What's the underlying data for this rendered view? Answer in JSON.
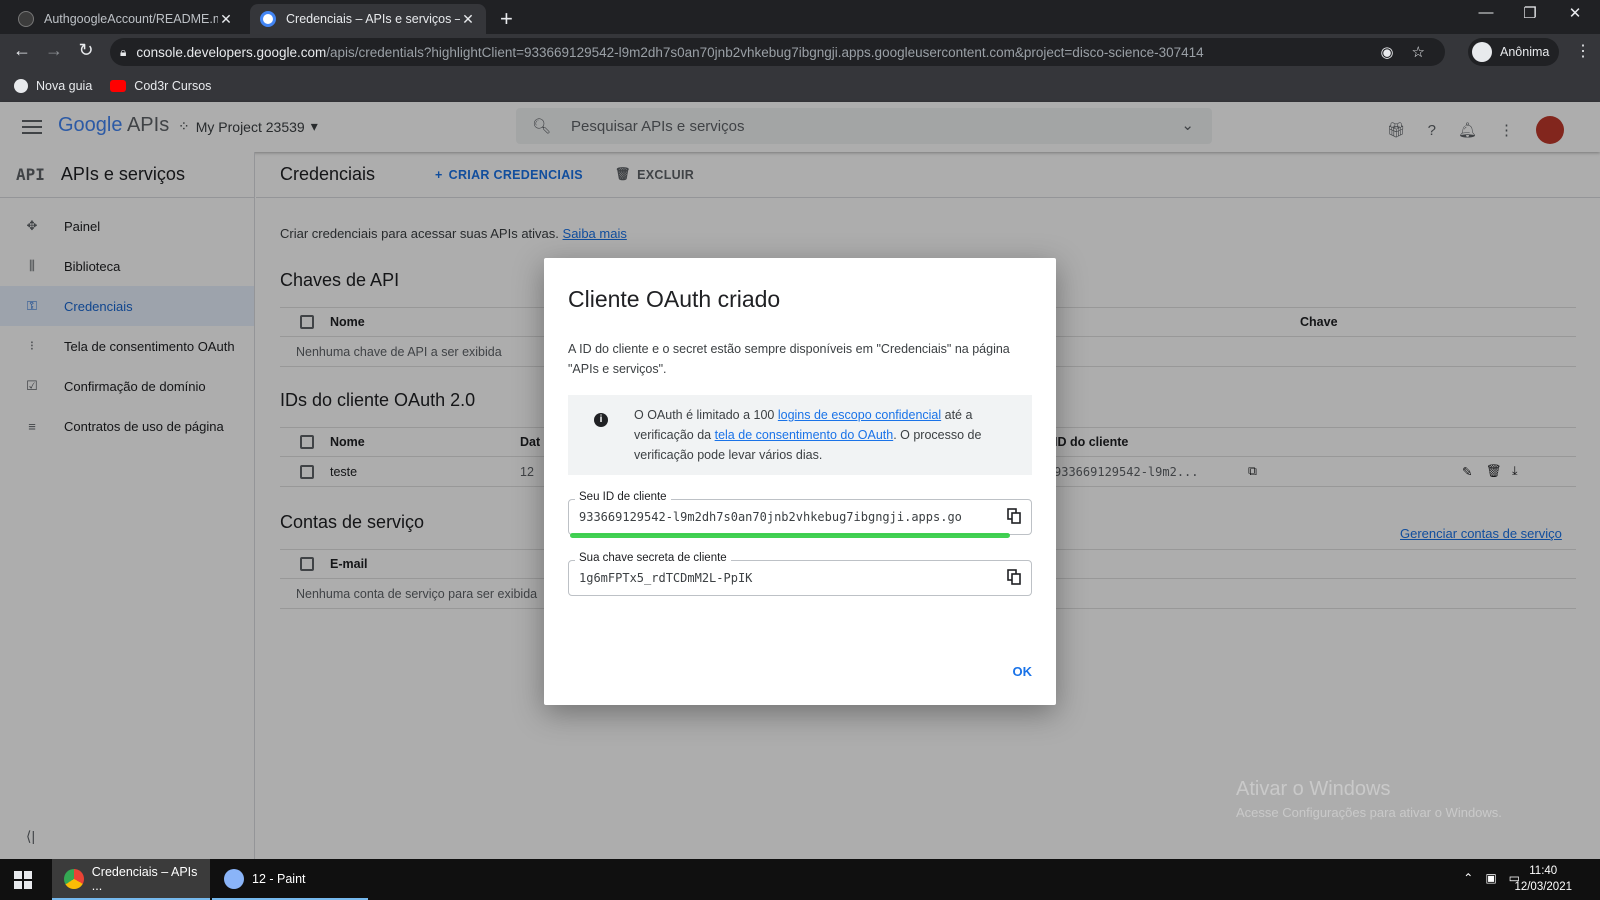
{
  "browser": {
    "tabs": [
      {
        "title": "AuthgoogleAccount/README.md"
      },
      {
        "title": "Credenciais – APIs e serviços – M"
      }
    ],
    "url_host": "console.developers.google.com",
    "url_path": "/apis/credentials?highlightClient=933669129542-l9m2dh7s0an70jnb2vhkebug7ibgngji.apps.googleusercontent.com&project=disco-science-307414",
    "profile_label": "Anônima",
    "bookmarks": [
      {
        "label": "Nova guia"
      },
      {
        "label": "Cod3r Cursos"
      }
    ]
  },
  "header": {
    "logo_google": "Google",
    "logo_apis": "APIs",
    "project": "My Project 23539",
    "search_placeholder": "Pesquisar APIs e serviços"
  },
  "sidebar": {
    "icon_text": "API",
    "title": "APIs e serviços",
    "items": [
      {
        "label": "Painel",
        "icon": "dashboard-icon"
      },
      {
        "label": "Biblioteca",
        "icon": "library-icon"
      },
      {
        "label": "Credenciais",
        "icon": "key-icon",
        "active": true
      },
      {
        "label": "Tela de consentimento OAuth",
        "icon": "consent-icon"
      },
      {
        "label": "Confirmação de domínio",
        "icon": "checkbox-icon"
      },
      {
        "label": "Contratos de uso de página",
        "icon": "settings-list-icon"
      }
    ]
  },
  "main": {
    "title": "Credenciais",
    "create_label": "CRIAR CREDENCIAIS",
    "delete_label": "EXCLUIR",
    "intro": "Criar credenciais para acessar suas APIs ativas.",
    "intro_link": "Saiba mais",
    "api_keys": {
      "title": "Chaves de API",
      "col_name": "Nome",
      "col_key": "Chave",
      "empty": "Nenhuma chave de API a ser exibida"
    },
    "oauth": {
      "title": "IDs do cliente OAuth 2.0",
      "col_name": "Nome",
      "col_date": "Dat",
      "col_client_id": "ID do cliente",
      "row_name": "teste",
      "row_date": "12",
      "row_client_id": "933669129542-l9m2..."
    },
    "service": {
      "title": "Contas de serviço",
      "col_email": "E-mail",
      "manage_link": "Gerenciar contas de serviço",
      "empty": "Nenhuma conta de serviço para ser exibida"
    }
  },
  "dialog": {
    "title": "Cliente OAuth criado",
    "description": "A ID do cliente e o secret estão sempre disponíveis em \"Credenciais\" na página \"APIs e serviços\".",
    "notice_pre": "O OAuth é limitado a 100 ",
    "notice_link1": "logins de escopo confidencial",
    "notice_mid": " até a verificação da ",
    "notice_link2": "tela de consentimento do OAuth",
    "notice_post": ". O processo de verificação pode levar vários dias.",
    "client_id_label": "Seu ID de cliente",
    "client_id_value": "933669129542-l9m2dh7s0an70jnb2vhkebug7ibgngji.apps.go",
    "secret_label": "Sua chave secreta de cliente",
    "secret_value": "1g6mFPTx5_rdTCDmM2L-PpIK",
    "ok_label": "OK"
  },
  "watermark": {
    "line1": "Ativar o Windows",
    "line2": "Acesse Configurações para ativar o Windows."
  },
  "taskbar": {
    "apps": [
      {
        "label": "Credenciais – APIs ..."
      },
      {
        "label": "12 - Paint"
      }
    ],
    "time": "11:40",
    "date": "12/03/2021"
  }
}
